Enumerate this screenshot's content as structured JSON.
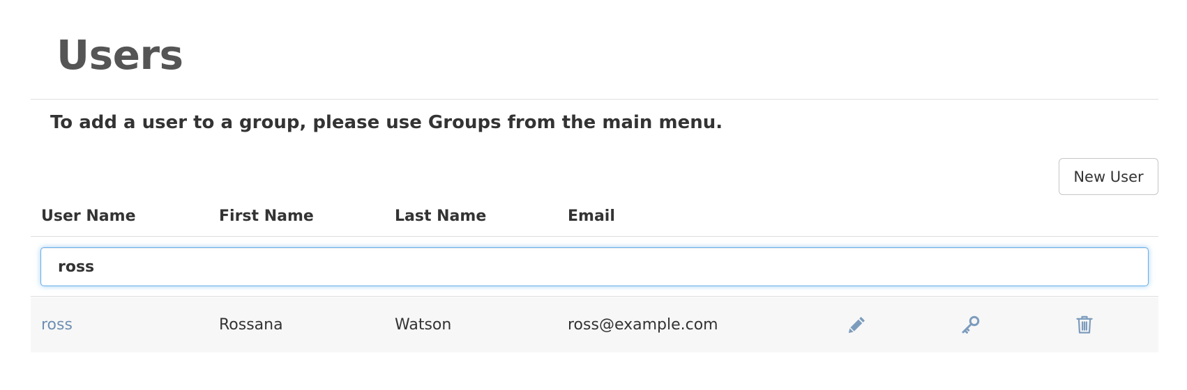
{
  "page": {
    "title": "Users",
    "info_text": "To add a user to a group, please use Groups from the main menu."
  },
  "toolbar": {
    "new_user_label": "New User"
  },
  "table": {
    "columns": [
      "User Name",
      "First Name",
      "Last Name",
      "Email"
    ],
    "filter": {
      "value": "ross",
      "placeholder": ""
    },
    "rows": [
      {
        "user_name": "ross",
        "first_name": "Rossana",
        "last_name": "Watson",
        "email": "ross@example.com",
        "actions": [
          "pencil-icon",
          "key-icon",
          "trash-icon"
        ]
      }
    ]
  },
  "colors": {
    "link": "#6e8fb2",
    "icon": "#7c9cbd",
    "row_bg": "#f7f7f7",
    "focus_border": "#66afe9",
    "title": "#555555"
  }
}
